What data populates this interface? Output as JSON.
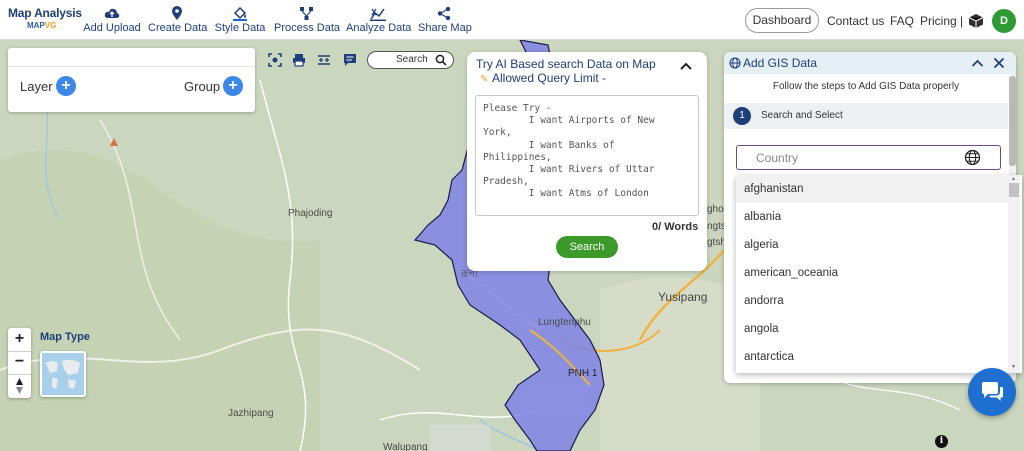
{
  "app": {
    "logo_title": "Map Analysis",
    "logo_sub_prefix": "MAP",
    "logo_sub_suffix": "VG"
  },
  "nav": [
    {
      "label": "Add Upload",
      "icon": "cloud-upload-icon"
    },
    {
      "label": "Create Data",
      "icon": "location-pin-icon"
    },
    {
      "label": "Style Data",
      "icon": "paint-bucket-icon"
    },
    {
      "label": "Process Data",
      "icon": "process-nodes-icon"
    },
    {
      "label": "Analyze Data",
      "icon": "analyze-icon"
    },
    {
      "label": "Share Map",
      "icon": "share-icon"
    }
  ],
  "top_right": {
    "dashboard": "Dashboard",
    "contact": "Contact us",
    "faq": "FAQ",
    "pricing": "Pricing |",
    "avatar_initial": "D"
  },
  "layer_panel": {
    "layer_label": "Layer",
    "group_label": "Group"
  },
  "map_search": {
    "placeholder": "Search"
  },
  "ai_panel": {
    "title_line1": "Try AI Based search Data on Map",
    "title_line2": "Allowed Query Limit -",
    "textarea_text": "Please Try -\n        I want Airports of New\nYork,\n        I want Banks of\nPhilippines,\n        I want Rivers of Uttar\nPradesh,\n        I want Atms of London",
    "word_count": "0/ Words",
    "search_button": "Search"
  },
  "gis_panel": {
    "title": "Add GIS Data",
    "subtitle": "Follow the steps to Add GIS Data properly",
    "step_number": "1",
    "step_label": "Search and Select",
    "country_placeholder": "Country",
    "country_options": [
      "afghanistan",
      "albania",
      "algeria",
      "american_oceania",
      "andorra",
      "angola",
      "antarctica"
    ]
  },
  "map": {
    "labels": [
      "Phajoding",
      "Yusipang",
      "Lungtenphu",
      "PNH 1",
      "Jazhipang",
      "Walupang",
      "Map Type"
    ],
    "partial_labels": [
      "gho",
      "ngtse",
      "gtsh",
      "রূপা"
    ]
  },
  "colors": {
    "brand_navy": "#1f3f7a",
    "accent_blue": "#3b88e8",
    "search_green": "#3c9a2b",
    "region_fill": "#7b7fe6",
    "avatar_green": "#2f9b35"
  }
}
